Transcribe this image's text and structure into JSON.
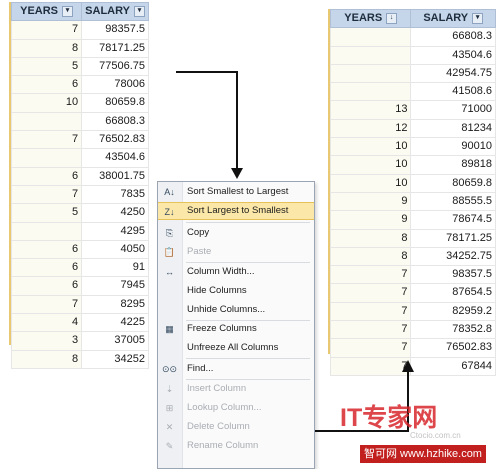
{
  "left_table": {
    "headers": [
      "YEARS",
      "SALARY"
    ],
    "rows": [
      [
        "7",
        "98357.5"
      ],
      [
        "8",
        "78171.25"
      ],
      [
        "5",
        "77506.75"
      ],
      [
        "6",
        "78006"
      ],
      [
        "10",
        "80659.8"
      ],
      [
        "",
        "66808.3"
      ],
      [
        "7",
        "76502.83"
      ],
      [
        "",
        "43504.6"
      ],
      [
        "6",
        "38001.75"
      ],
      [
        "7",
        "7835"
      ],
      [
        "5",
        "4250"
      ],
      [
        "",
        "4295"
      ],
      [
        "6",
        "4050"
      ],
      [
        "6",
        "91"
      ],
      [
        "6",
        "7945"
      ],
      [
        "7",
        "8295"
      ],
      [
        "4",
        "4225"
      ],
      [
        "3",
        "37005"
      ],
      [
        "8",
        "34252"
      ]
    ]
  },
  "right_table": {
    "headers": [
      "YEARS",
      "SALARY"
    ],
    "rows": [
      [
        "",
        "66808.3"
      ],
      [
        "",
        "43504.6"
      ],
      [
        "",
        "42954.75"
      ],
      [
        "",
        "41508.6"
      ],
      [
        "13",
        "71000"
      ],
      [
        "12",
        "81234"
      ],
      [
        "10",
        "90010"
      ],
      [
        "10",
        "89818"
      ],
      [
        "10",
        "80659.8"
      ],
      [
        "9",
        "88555.5"
      ],
      [
        "9",
        "78674.5"
      ],
      [
        "8",
        "78171.25"
      ],
      [
        "8",
        "34252.75"
      ],
      [
        "7",
        "98357.5"
      ],
      [
        "7",
        "87654.5"
      ],
      [
        "7",
        "82959.2"
      ],
      [
        "7",
        "78352.8"
      ],
      [
        "7",
        "76502.83"
      ],
      [
        "7",
        "67844"
      ]
    ]
  },
  "context_menu": {
    "items": [
      {
        "label": "Sort Smallest to Largest",
        "icon": "sort-ascending-icon",
        "enabled": true
      },
      {
        "label": "Sort Largest to Smallest",
        "icon": "sort-descending-icon",
        "enabled": true,
        "highlighted": true
      },
      {
        "label": "Copy",
        "icon": "copy-icon",
        "enabled": true
      },
      {
        "label": "Paste",
        "icon": "paste-icon",
        "enabled": false
      },
      {
        "label": "Column Width...",
        "icon": "column-width-icon",
        "enabled": true
      },
      {
        "label": "Hide Columns",
        "icon": "",
        "enabled": true
      },
      {
        "label": "Unhide Columns...",
        "icon": "",
        "enabled": true
      },
      {
        "label": "Freeze Columns",
        "icon": "freeze-icon",
        "enabled": true
      },
      {
        "label": "Unfreeze All Columns",
        "icon": "",
        "enabled": true
      },
      {
        "label": "Find...",
        "icon": "binoculars-icon",
        "enabled": true
      },
      {
        "label": "Insert Column",
        "icon": "insert-column-icon",
        "enabled": false
      },
      {
        "label": "Lookup Column...",
        "icon": "lookup-column-icon",
        "enabled": false
      },
      {
        "label": "Delete Column",
        "icon": "delete-column-icon",
        "enabled": false
      },
      {
        "label": "Rename Column",
        "icon": "rename-column-icon",
        "enabled": false
      }
    ]
  },
  "watermark": {
    "logo_text": "IT专家网",
    "sub_text": "Ctocio.com.cn",
    "site_text": "智可网 www.hzhike.com"
  },
  "colors": {
    "header_bg": "#c5d6ea",
    "highlight": "#fbe7a7",
    "watermark_red": "#d8262b",
    "edge": "#e8c971"
  }
}
